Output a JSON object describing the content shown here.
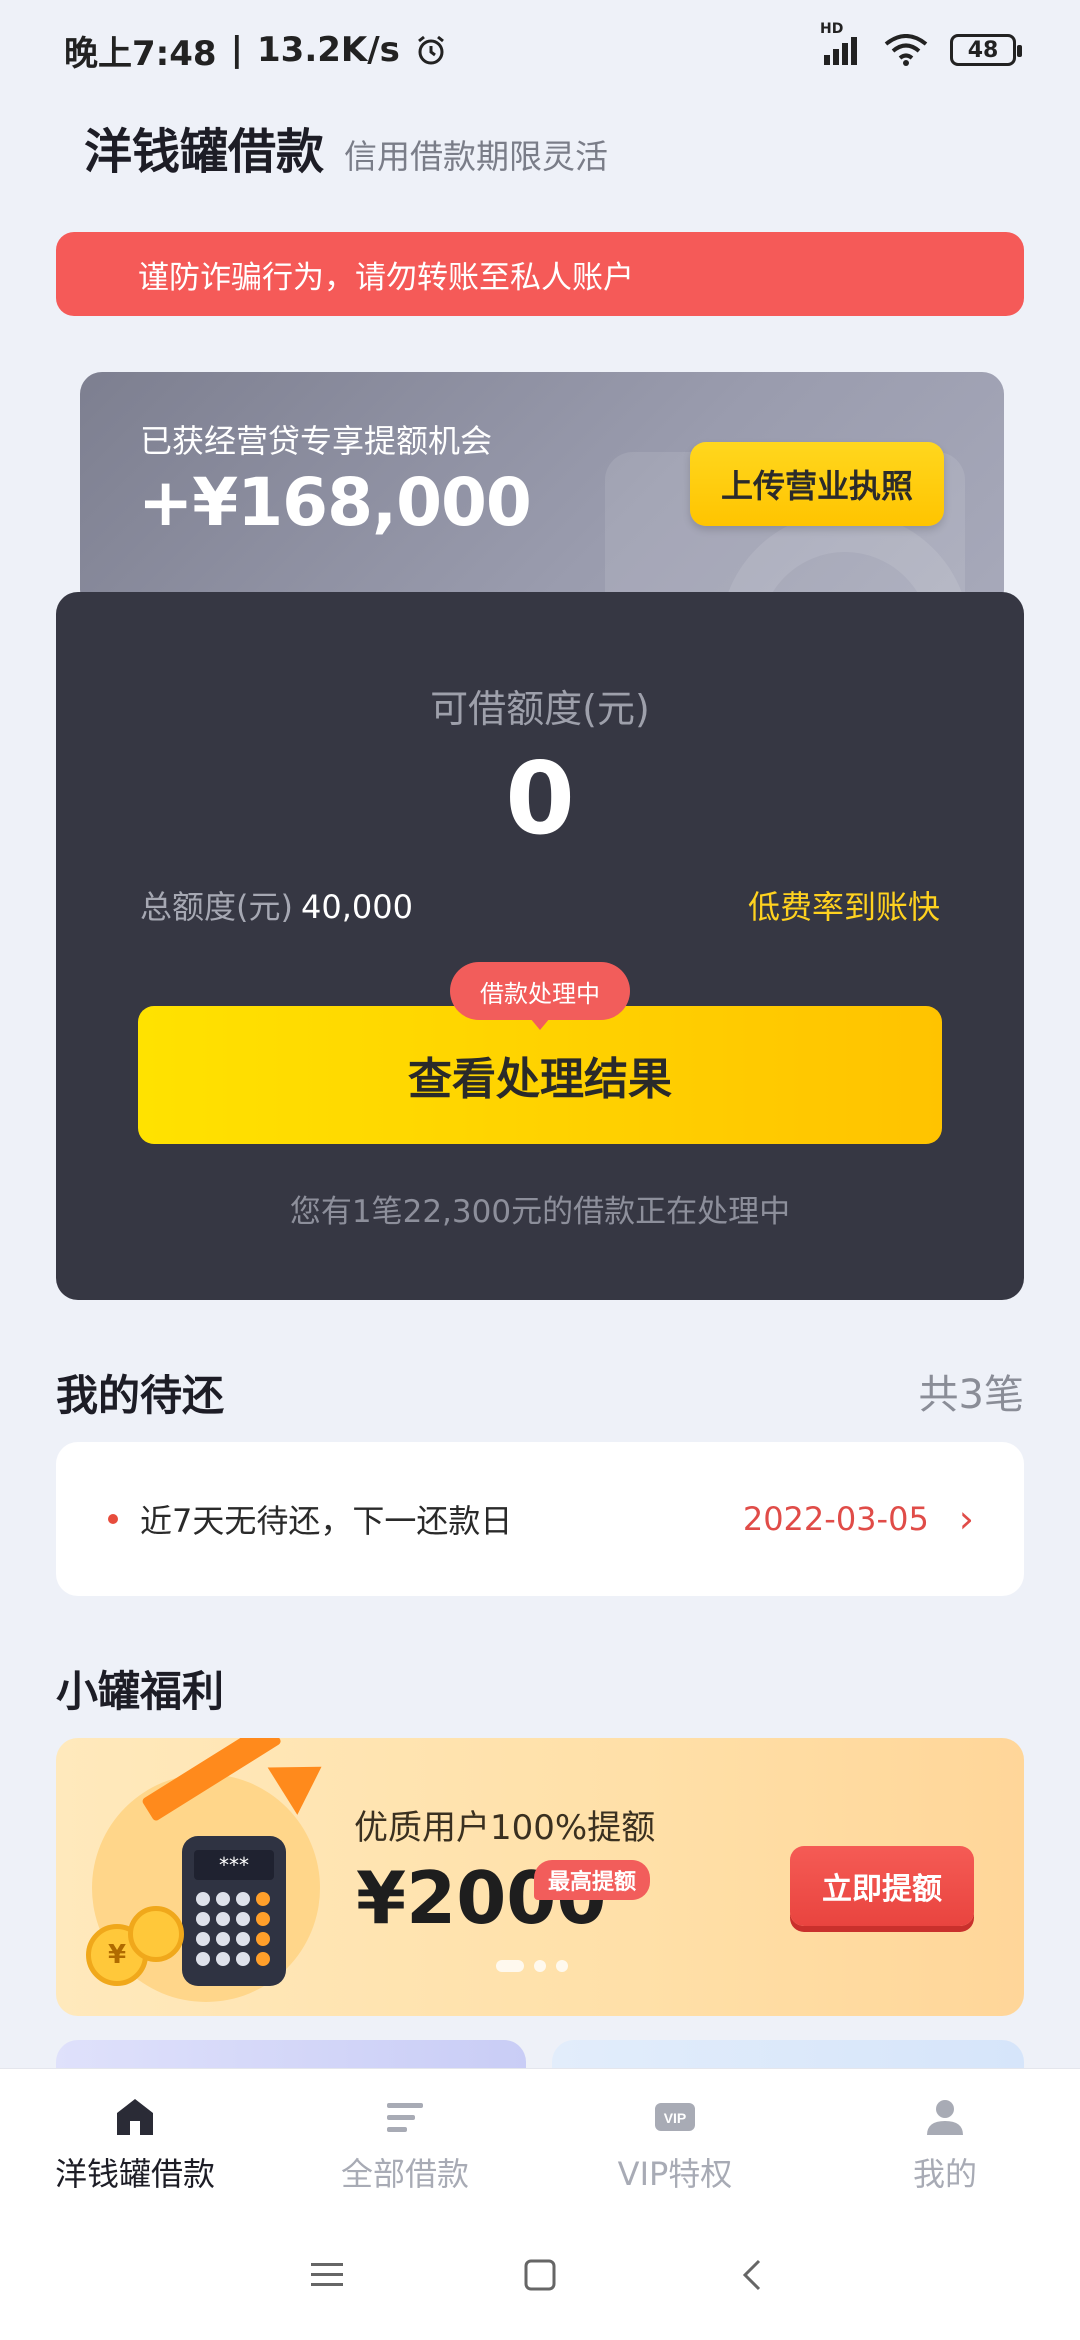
{
  "status_bar": {
    "time": "晚上7:48",
    "separator": "|",
    "network_speed": "13.2K/s",
    "signal_label": "HD",
    "battery": "48"
  },
  "header": {
    "title": "洋钱罐借款",
    "subtitle": "信用借款期限灵活"
  },
  "warning": "谨防诈骗行为，请勿转账至私人账户",
  "promo": {
    "label": "已获经营贷专享提额机会",
    "amount": "+¥168,000",
    "button": "上传营业执照"
  },
  "credit": {
    "available_label": "可借额度(元)",
    "available_value": "0",
    "total_label": "总额度(元)",
    "total_value": "40,000",
    "fee_tag": "低费率到账快",
    "badge": "借款处理中",
    "button": "查看处理结果",
    "note": "您有1笔22,300元的借款正在处理中"
  },
  "repayment": {
    "title": "我的待还",
    "count": "共3笔",
    "text": "近7天无待还，下一还款日",
    "date": "2022-03-05"
  },
  "benefits": {
    "title": "小罐福利",
    "line1": "优质用户100%提额",
    "amount": "¥2000",
    "tag": "最高提额",
    "button": "立即提额",
    "calc_screen": "***",
    "coin_symbol": "¥"
  },
  "tabs": [
    {
      "label": "洋钱罐借款",
      "icon": "home-icon"
    },
    {
      "label": "全部借款",
      "icon": "list-icon"
    },
    {
      "label": "VIP特权",
      "icon": "vip-icon"
    },
    {
      "label": "我的",
      "icon": "person-icon"
    }
  ],
  "colors": {
    "accent_yellow": "#ffd21f",
    "warning_red": "#f55a58",
    "card_dark": "#363743"
  }
}
